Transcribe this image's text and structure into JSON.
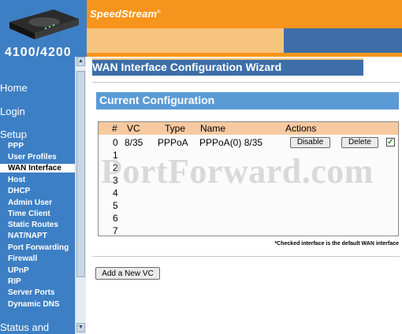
{
  "header": {
    "brand": "SpeedStream",
    "trademark": "®",
    "model_partial": "4100/4200"
  },
  "sidebar": {
    "home": "Home",
    "login": "Login",
    "setup": "Setup",
    "items": [
      "PPP",
      "User Profiles",
      "WAN Interface",
      "Host",
      "DHCP",
      "Admin User",
      "Time Client",
      "Static Routes",
      "NAT/NAPT",
      "Port Forwarding",
      "Firewall",
      "UPnP",
      "RIP",
      "Server Ports",
      "Dynamic DNS"
    ],
    "active_item": "WAN Interface",
    "status": "Status and"
  },
  "main": {
    "title": "WAN Interface Configuration Wizard",
    "section_title": "Current Configuration",
    "table": {
      "headers": {
        "num": "#",
        "vc": "VC",
        "type": "Type",
        "name": "Name",
        "actions": "Actions"
      },
      "row0": {
        "num": "0",
        "vc": "8/35",
        "type": "PPPoA",
        "name": "PPPoA(0) 8/35",
        "disable": "Disable",
        "delete": "Delete",
        "checked": true
      },
      "empty_rows": [
        "1",
        "2",
        "3",
        "4",
        "5",
        "6",
        "7"
      ]
    },
    "footnote": "*Checked interface is the default WAN interface",
    "add_button": "Add a New VC"
  },
  "watermark": "PortForward.com",
  "colors": {
    "header_orange": "#f7941d",
    "sidebar_blue": "#3d7fc4",
    "title_blue": "#3d6ea8",
    "section_blue": "#5b9bd5",
    "table_header": "#f7c9a0"
  }
}
